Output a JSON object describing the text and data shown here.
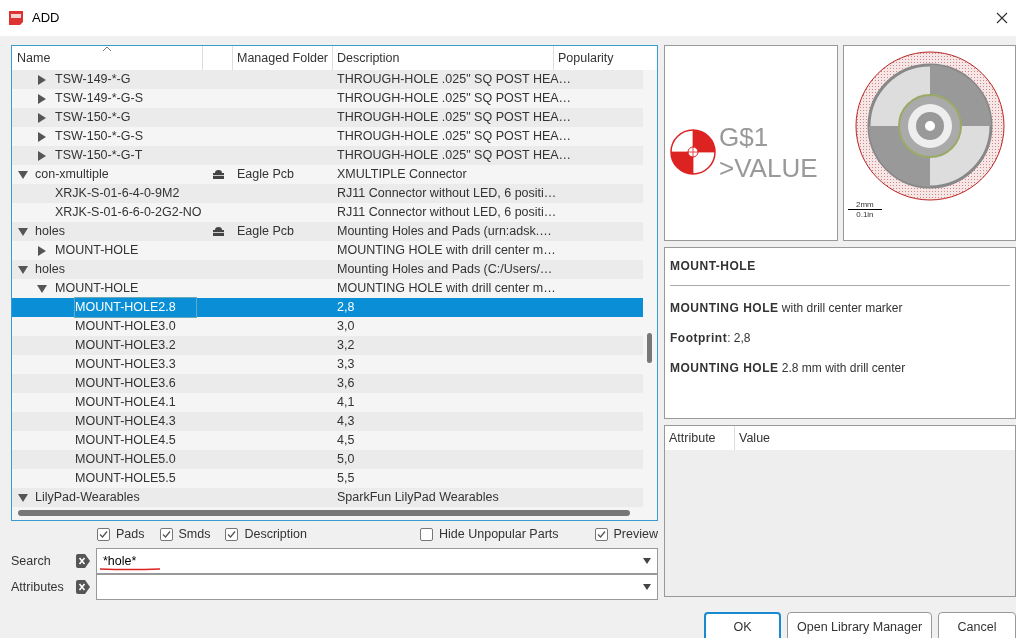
{
  "window": {
    "title": "ADD"
  },
  "table": {
    "columns": [
      "Name",
      "Managed Folder",
      "Description",
      "Popularity"
    ],
    "rows": [
      {
        "children": [
          {
            "name": "TSW-149-*-G",
            "description": "THROUGH-HOLE .025\" SQ POST HEA…",
            "expanded": false,
            "selected": false
          },
          {
            "name": "TSW-149-*-G-S",
            "description": "THROUGH-HOLE .025\" SQ POST HEA…",
            "expanded": false,
            "selected": false
          },
          {
            "name": "TSW-150-*-G",
            "description": "THROUGH-HOLE .025\" SQ POST HEA…",
            "expanded": false,
            "selected": false
          },
          {
            "name": "TSW-150-*-G-S",
            "description": "THROUGH-HOLE .025\" SQ POST HEA…",
            "expanded": false,
            "selected": false
          },
          {
            "name": "TSW-150-*-G-T",
            "description": "THROUGH-HOLE .025\" SQ POST HEA…",
            "expanded": false,
            "selected": false
          }
        ]
      },
      {
        "name": "con-xmultiple",
        "folder": "Eagle Pcb",
        "description": "XMULTIPLE Connector",
        "expanded": true,
        "selected": false,
        "children": [
          {
            "name": "XRJK-S-01-6-4-0-9M2",
            "description": "RJ11 Connector without LED, 6 positi…",
            "selected": false
          },
          {
            "name": "XRJK-S-01-6-6-0-2G2-NO",
            "description": "RJ11 Connector without LED, 6 positi…",
            "selected": false
          }
        ]
      },
      {
        "name": "holes",
        "folder": "Eagle Pcb",
        "description": "Mounting Holes and Pads (urn:adsk.…",
        "expanded": true,
        "selected": false,
        "children": [
          {
            "name": "MOUNT-HOLE",
            "description": "MOUNTING HOLE with drill center m…",
            "expanded": false,
            "selected": false
          }
        ]
      },
      {
        "name": "holes",
        "description": "Mounting Holes and Pads (C:/Users/…",
        "expanded": true,
        "selected": false,
        "children": [
          {
            "name": "MOUNT-HOLE",
            "description": "MOUNTING HOLE with drill center m…",
            "expanded": true,
            "selected": false,
            "children": [
              {
                "name": "MOUNT-HOLE2.8",
                "description": "2,8",
                "selected": true
              },
              {
                "name": "MOUNT-HOLE3.0",
                "description": "3,0",
                "selected": false
              },
              {
                "name": "MOUNT-HOLE3.2",
                "description": "3,2",
                "selected": false
              },
              {
                "name": "MOUNT-HOLE3.3",
                "description": "3,3",
                "selected": false
              },
              {
                "name": "MOUNT-HOLE3.6",
                "description": "3,6",
                "selected": false
              },
              {
                "name": "MOUNT-HOLE4.1",
                "description": "4,1",
                "selected": false
              },
              {
                "name": "MOUNT-HOLE4.3",
                "description": "4,3",
                "selected": false
              },
              {
                "name": "MOUNT-HOLE4.5",
                "description": "4,5",
                "selected": false
              },
              {
                "name": "MOUNT-HOLE5.0",
                "description": "5,0",
                "selected": false
              },
              {
                "name": "MOUNT-HOLE5.5",
                "description": "5,5",
                "selected": false
              }
            ]
          }
        ]
      },
      {
        "name": "LilyPad-Wearables",
        "description": "SparkFun LilyPad Wearables",
        "expanded": true,
        "selected": false
      }
    ]
  },
  "filters": [
    {
      "label": "Pads",
      "checked": true
    },
    {
      "label": "Smds",
      "checked": true
    },
    {
      "label": "Description",
      "checked": true
    },
    {
      "label": "Hide Unpopular Parts",
      "checked": false
    },
    {
      "label": "Preview",
      "checked": true
    }
  ],
  "search": {
    "label": "Search",
    "value": "*hole*"
  },
  "attributes_field": {
    "label": "Attributes"
  },
  "symbol_preview": {
    "name": "G$1",
    "value": ">VALUE"
  },
  "package_preview": {
    "scale_metric": "2mm",
    "scale_imperial": "0.1in"
  },
  "info": {
    "title": "MOUNT-HOLE",
    "paragraphs": [
      "**MOUNTING HOLE** with drill center marker",
      "**Footprint**: 2,8",
      "**MOUNTING HOLE** 2.8 mm with drill center"
    ]
  },
  "attribute_table": {
    "columns": [
      "Attribute",
      "Value"
    ]
  },
  "buttons": [
    "OK",
    "Open Library Manager",
    "Cancel"
  ]
}
